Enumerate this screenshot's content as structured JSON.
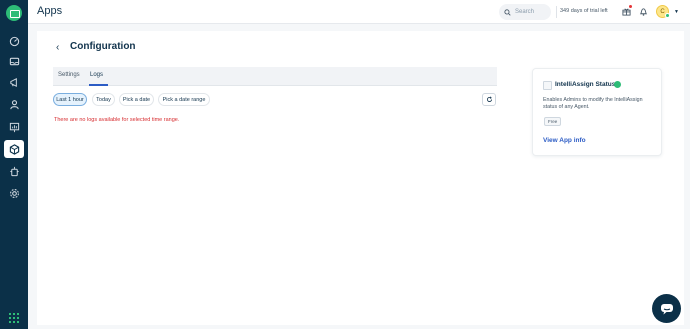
{
  "topbar": {
    "app_title": "Apps",
    "search_placeholder": "Search",
    "trial_text": "349 days of trial left",
    "avatar_initial": "C"
  },
  "sidebar": {
    "items": [
      {
        "name": "dashboard-icon",
        "active": false
      },
      {
        "name": "inbox-icon",
        "active": false
      },
      {
        "name": "megaphone-icon",
        "active": false
      },
      {
        "name": "contacts-icon",
        "active": false
      },
      {
        "name": "reports-icon",
        "active": false
      },
      {
        "name": "apps-icon",
        "active": true
      },
      {
        "name": "bot-icon",
        "active": false
      },
      {
        "name": "settings-icon",
        "active": false
      }
    ]
  },
  "page": {
    "back_symbol": "‹",
    "title": "Configuration",
    "tabs": [
      "Settings",
      "Logs"
    ],
    "active_tab": "Logs",
    "filters": [
      "Last 1 hour",
      "Today",
      "Pick a date",
      "Pick a date range"
    ],
    "active_filter": "Last 1 hour",
    "empty_message": "There are no logs available for selected time range."
  },
  "app_card": {
    "title": "IntelliAssign Status",
    "description": "Enables Admins to modify the IntelliAssign status of any Agent.",
    "badge": "Free",
    "link": "View App info"
  },
  "colors": {
    "sidebar_bg": "#0b3048",
    "brand_green": "#2dbc77",
    "link_blue": "#2c5cc5",
    "error_red": "#d72d30"
  }
}
